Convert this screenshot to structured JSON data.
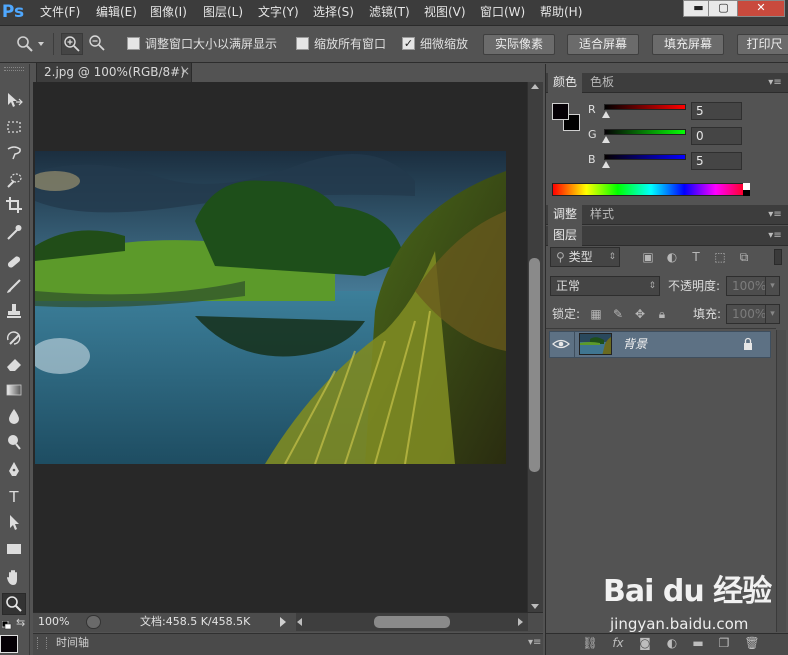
{
  "app": {
    "logo": "Ps"
  },
  "menu": [
    "文件(F)",
    "编辑(E)",
    "图像(I)",
    "图层(L)",
    "文字(Y)",
    "选择(S)",
    "滤镜(T)",
    "视图(V)",
    "窗口(W)",
    "帮助(H)"
  ],
  "window_controls": {
    "minimize": "▬",
    "maximize": "▢",
    "close": "✕"
  },
  "options": {
    "resize_windows_label": "调整窗口大小以满屏显示",
    "resize_windows_checked": false,
    "zoom_all_label": "缩放所有窗口",
    "zoom_all_checked": false,
    "scrubby_zoom_label": "细微缩放",
    "scrubby_zoom_checked": true,
    "actual_pixels": "实际像素",
    "fit_screen": "适合屏幕",
    "fill_screen": "填充屏幕",
    "print_size": "打印尺"
  },
  "document": {
    "tab_title": "2.jpg @ 100%(RGB/8#)",
    "close": "×",
    "zoom": "100%",
    "doc_size": "文档:458.5 K/458.5K",
    "timeline_label": "时间轴"
  },
  "color_panel": {
    "tabs": [
      "颜色",
      "色板"
    ],
    "r_label": "R",
    "r_value": "5",
    "g_label": "G",
    "g_value": "0",
    "b_label": "B",
    "b_value": "5",
    "foreground": "#050005",
    "background": "#000000"
  },
  "adjust_panel": {
    "tabs": [
      "调整",
      "样式"
    ]
  },
  "layers_panel": {
    "tab": "图层",
    "filter_kind": "类型",
    "blend_mode": "正常",
    "opacity_label": "不透明度:",
    "opacity_value": "100%",
    "lock_label": "锁定:",
    "fill_label": "填充:",
    "fill_value": "100%",
    "layers": [
      {
        "name": "背景",
        "visible": true,
        "locked": true
      }
    ]
  },
  "watermark": {
    "logo": "Bai du 经验",
    "url": "jingyan.baidu.com"
  },
  "colors": {
    "accent": "#4fa8ff",
    "selected_layer": "#5d7184",
    "ui_bg": "#535353",
    "canvas_bg": "#282828"
  }
}
